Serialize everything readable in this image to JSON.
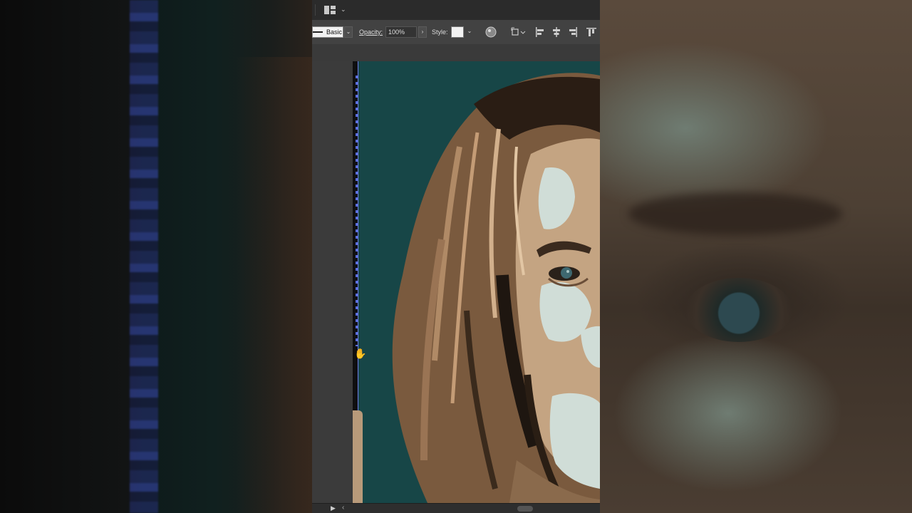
{
  "toolbar": {
    "workspace_icon": "workspace-switcher-icon",
    "stroke_style_label": "Basic",
    "opacity_label": "Opacity:",
    "opacity_value": "100%",
    "style_label": "Style:",
    "icons": [
      "recolor-artwork-icon",
      "transform-icon",
      "align-left-icon",
      "align-center-icon",
      "align-right-icon",
      "align-top-icon"
    ]
  },
  "canvas": {
    "artboard_background": "#174647",
    "subject": "posterized vector portrait",
    "cursor": "hand-cursor"
  },
  "colors": {
    "accent_selection": "#5b6fe0",
    "hair": "#8a6748",
    "skin_highlight": "#cfdcd6",
    "skin_mid": "#b89a7a"
  },
  "statusbar": {
    "play_icon": "play-icon",
    "prev_icon": "chevron-left-icon"
  }
}
